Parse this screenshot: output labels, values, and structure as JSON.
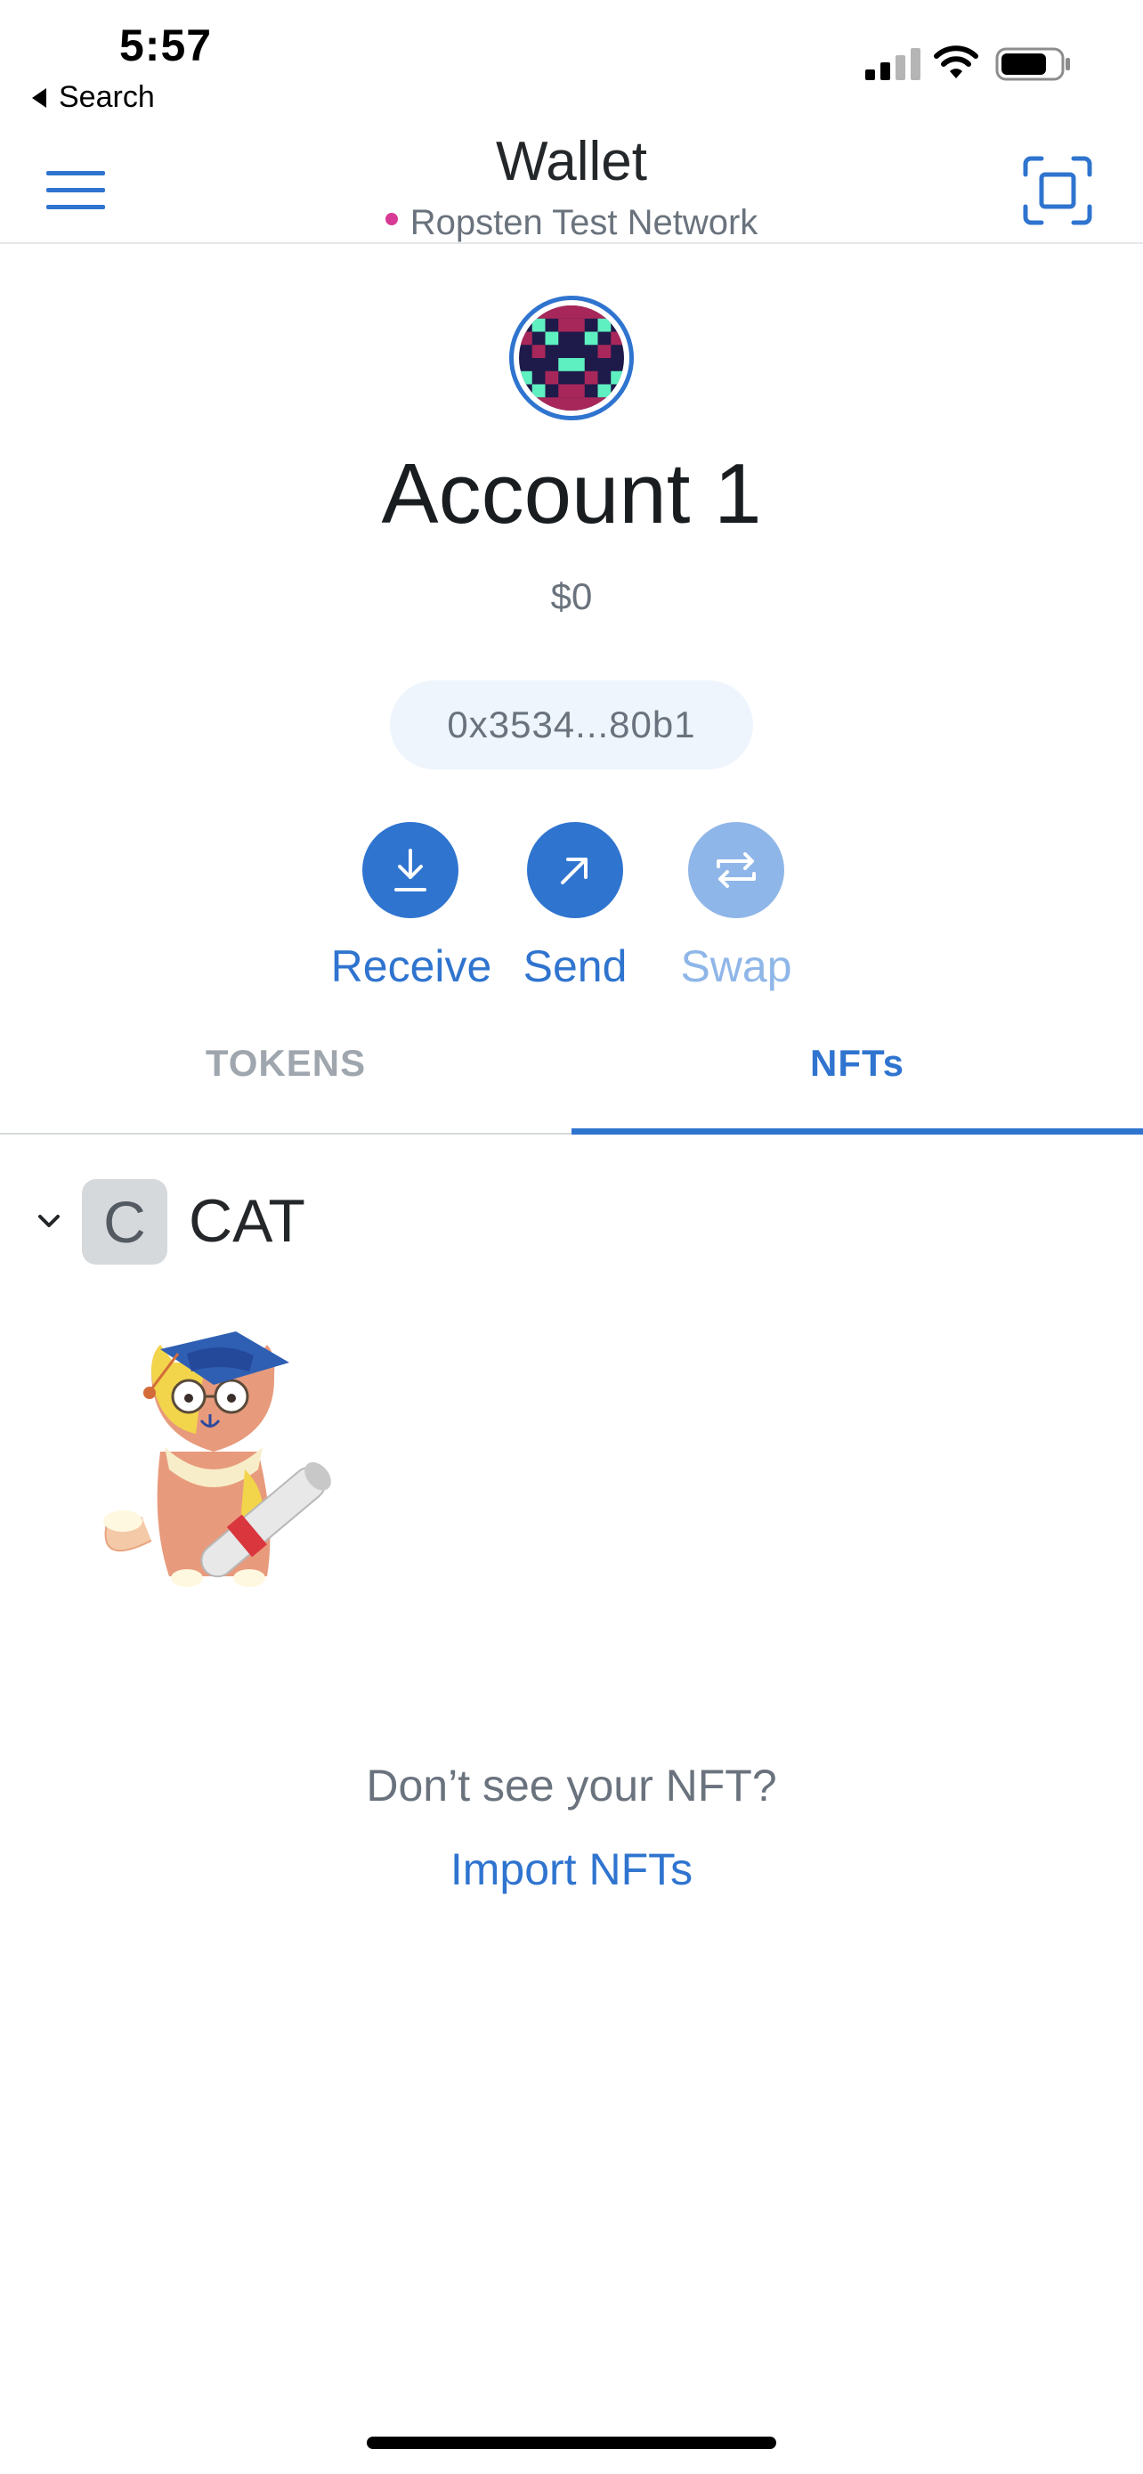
{
  "status_bar": {
    "time": "5:57",
    "back_label": "Search"
  },
  "header": {
    "title": "Wallet",
    "network": "Ropsten Test Network"
  },
  "account": {
    "name": "Account 1",
    "balance": "$0",
    "address": "0x3534...80b1"
  },
  "actions": [
    {
      "label": "Receive",
      "icon": "download-icon",
      "enabled": true
    },
    {
      "label": "Send",
      "icon": "arrow-up-right-icon",
      "enabled": true
    },
    {
      "label": "Swap",
      "icon": "swap-icon",
      "enabled": false
    }
  ],
  "tabs": [
    {
      "label": "TOKENS",
      "active": false
    },
    {
      "label": "NFTs",
      "active": true
    }
  ],
  "collection": {
    "badge_letter": "C",
    "name": "CAT"
  },
  "empty_prompt": {
    "question": "Don’t see your NFT?",
    "link": "Import NFTs"
  },
  "colors": {
    "accent": "#2f74cf",
    "accent_disabled": "#8fb6e8",
    "network_dot": "#d73a95",
    "muted_text": "#6a737d"
  }
}
